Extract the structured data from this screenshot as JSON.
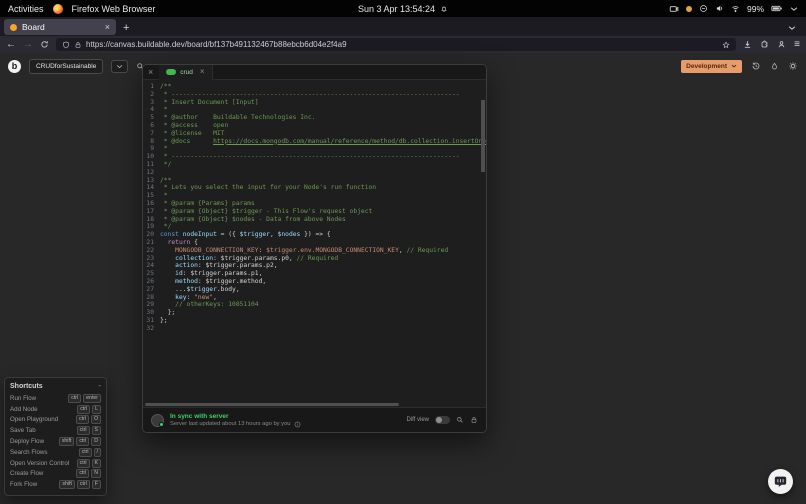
{
  "glyphs": {
    "close": "×",
    "plus": "+",
    "menu": "≡",
    "back": "←",
    "forward": "→",
    "collapse": "-",
    "logo_letter": "b"
  },
  "desktop": {
    "activities_label": "Activities",
    "focused_app": "Firefox Web Browser",
    "clock": "Sun 3 Apr 13:54:24",
    "battery_percent": "99%"
  },
  "browser": {
    "tab_title": "Board",
    "url": "https://canvas.buildable.dev/board/bf137b491132467b88ebcb6d04e2f4a9"
  },
  "app": {
    "board_name": "CRUDforSustainable",
    "environment_label": "Development"
  },
  "editor": {
    "tab_label": "crud",
    "status": {
      "sync_message": "In sync with server",
      "detail_message": "Server last updated about 13 hours ago by you",
      "diff_toggle_label": "Diff view"
    },
    "code": {
      "language": "javascript",
      "lines": [
        [
          [
            "c",
            "/**"
          ]
        ],
        [
          [
            "c",
            " * ----------------------------------------------------------------------------"
          ]
        ],
        [
          [
            "c",
            " * Insert Document [Input]"
          ]
        ],
        [
          [
            "c",
            " *"
          ]
        ],
        [
          [
            "c",
            " * @author    Buildable Technologies Inc."
          ]
        ],
        [
          [
            "c",
            " * @access    open"
          ]
        ],
        [
          [
            "c",
            " * @license   MIT"
          ]
        ],
        [
          [
            "c",
            " * @docs      "
          ],
          [
            "l",
            "https://docs.mongodb.com/manual/reference/method/db.collection.insertOne/"
          ]
        ],
        [
          [
            "c",
            " *"
          ]
        ],
        [
          [
            "c",
            " * ----------------------------------------------------------------------------"
          ]
        ],
        [
          [
            "c",
            " */"
          ]
        ],
        [],
        [
          [
            "c",
            "/**"
          ]
        ],
        [
          [
            "c",
            " * Lets you select the input for your Node's run function"
          ]
        ],
        [
          [
            "c",
            " *"
          ]
        ],
        [
          [
            "c",
            " * @param {Params} params"
          ]
        ],
        [
          [
            "c",
            " * @param {Object} $trigger - This Flow's request object"
          ]
        ],
        [
          [
            "c",
            " * @param {Object} $nodes - Data from above Nodes"
          ]
        ],
        [
          [
            "c",
            " */"
          ]
        ],
        [
          [
            "k",
            "const"
          ],
          [
            "d",
            " "
          ],
          [
            "v",
            "nodeInput"
          ],
          [
            "d",
            " = ({ "
          ],
          [
            "v",
            "$trigger"
          ],
          [
            "d",
            ", "
          ],
          [
            "v",
            "$nodes"
          ],
          [
            "d",
            " }) => {"
          ]
        ],
        [
          [
            "d",
            "  "
          ],
          [
            "r",
            "return"
          ],
          [
            "d",
            " {"
          ]
        ],
        [
          [
            "d",
            "    "
          ],
          [
            "w",
            "MONGODB_CONNECTION_KEY"
          ],
          [
            "d",
            ": "
          ],
          [
            "w",
            "$trigger.env.MONGODB_CONNECTION_KEY"
          ],
          [
            "d",
            ", "
          ],
          [
            "c",
            "// Required"
          ]
        ],
        [
          [
            "d",
            "    "
          ],
          [
            "p",
            "collection"
          ],
          [
            "d",
            ": $trigger.params.p0, "
          ],
          [
            "c",
            "// Required"
          ]
        ],
        [
          [
            "d",
            "    "
          ],
          [
            "p",
            "action"
          ],
          [
            "d",
            ": $trigger.params.p2,"
          ]
        ],
        [
          [
            "d",
            "    "
          ],
          [
            "p",
            "id"
          ],
          [
            "d",
            ": $trigger.params.p1,"
          ]
        ],
        [
          [
            "d",
            "    "
          ],
          [
            "p",
            "method"
          ],
          [
            "d",
            ": $trigger.method,"
          ]
        ],
        [
          [
            "d",
            "    ..."
          ],
          [
            "v",
            "$trigger"
          ],
          [
            "d",
            ".body,"
          ]
        ],
        [
          [
            "d",
            "    "
          ],
          [
            "p",
            "key"
          ],
          [
            "d",
            ": "
          ],
          [
            "s",
            "\"new\""
          ],
          [
            "d",
            ","
          ]
        ],
        [
          [
            "d",
            "    "
          ],
          [
            "c",
            "// otherKeys: 10851104"
          ]
        ],
        [
          [
            "d",
            "  };"
          ]
        ],
        [
          [
            "d",
            "};"
          ]
        ],
        []
      ]
    }
  },
  "shortcuts": {
    "title": "Shortcuts",
    "items": [
      {
        "label": "Run Flow",
        "keys": [
          "ctrl",
          "enter"
        ]
      },
      {
        "label": "Add Node",
        "keys": [
          "ctrl",
          "L"
        ]
      },
      {
        "label": "Open Playground",
        "keys": [
          "ctrl",
          "O"
        ]
      },
      {
        "label": "Save Tab",
        "keys": [
          "ctrl",
          "S"
        ]
      },
      {
        "label": "Deploy Flow",
        "keys": [
          "shift",
          "ctrl",
          "D"
        ]
      },
      {
        "label": "Search Flows",
        "keys": [
          "ctrl",
          "/"
        ]
      },
      {
        "label": "Open Version Control",
        "keys": [
          "ctrl",
          "K"
        ]
      },
      {
        "label": "Create Flow",
        "keys": [
          "ctrl",
          "N"
        ]
      },
      {
        "label": "Fork Flow",
        "keys": [
          "shift",
          "ctrl",
          "F"
        ]
      }
    ]
  },
  "colors": {
    "environment_button": "#E89C6B",
    "sync_green": "#3FCF6E",
    "node_badge_green": "#3FB950",
    "comment_green": "#6A9955"
  }
}
